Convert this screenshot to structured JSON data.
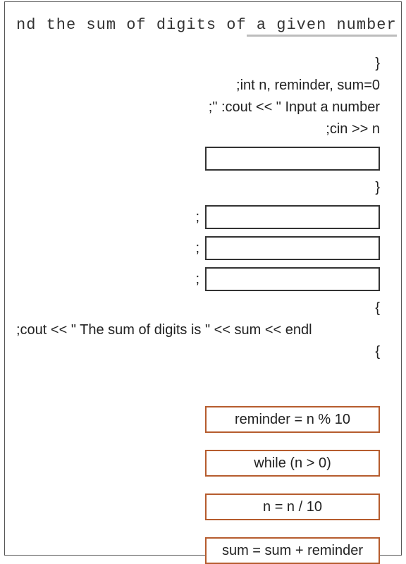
{
  "title": {
    "prefix": "nd the sum of digits of",
    "underlined": " a given number"
  },
  "code": {
    "l1": "}",
    "l2": ";int n, reminder, sum=0",
    "l3": ";\" :cout << \" Input a number",
    "l4": ";cin >> n",
    "l5brace": "}",
    "l6brace": "{",
    "l7": ";cout << \" The sum of digits is \" << sum << endl",
    "l8brace": "{"
  },
  "slots": {
    "semi": ";"
  },
  "answers": [
    "reminder = n % 10",
    "while (n > 0)",
    "n = n / 10",
    "sum = sum + reminder"
  ]
}
